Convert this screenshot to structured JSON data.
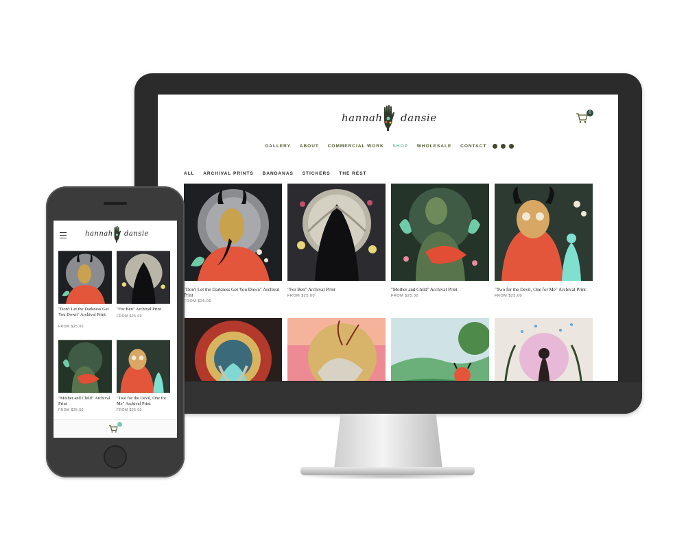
{
  "brand": {
    "left_word": "hannah",
    "right_word": "dansie"
  },
  "desktop": {
    "cart_count": "0",
    "nav": [
      "GALLERY",
      "ABOUT",
      "COMMERCIAL WORK",
      "SHOP",
      "WHOLESALE",
      "CONTACT"
    ],
    "active_nav": "SHOP",
    "filters": [
      "ALL",
      "ARCHIVAL PRINTS",
      "BANDANAS",
      "STICKERS",
      "THE REST"
    ],
    "products": [
      {
        "title": "\"Don't Let the Darkness Get You Down\" Archival Print",
        "price": "FROM $25.00"
      },
      {
        "title": "\"For Ben\" Archival Print",
        "price": "FROM $25.00"
      },
      {
        "title": "\"Mother and Child\" Archival Print",
        "price": "FROM $25.00"
      },
      {
        "title": "\"Two for the Devil, One for Me\" Archival Print",
        "price": "FROM $25.00"
      }
    ]
  },
  "mobile": {
    "products": [
      {
        "title": "\"Don't Let the Darkness Get You Down\" Archival Print",
        "price": "FROM $25.00"
      },
      {
        "title": "\"For Ben\" Archival Print",
        "price": "FROM $25.00"
      },
      {
        "title": "\"Mother and Child\" Archival Print",
        "price": "FROM $25.00"
      },
      {
        "title": "\"Two for the Devil, One for Me\" Archival Print",
        "price": "FROM $25.00"
      }
    ]
  },
  "colors": {
    "nav_text": "#4f5a2e",
    "nav_active": "#7ab6a3",
    "cart_badge": "#2f4a3a",
    "mobile_cart_badge": "#7ac7b4",
    "device_frame": "#2b2b2b"
  },
  "icons": [
    "hand-logo-icon",
    "cart-icon",
    "instagram-icon",
    "facebook-icon",
    "email-icon",
    "hamburger-menu-icon"
  ]
}
